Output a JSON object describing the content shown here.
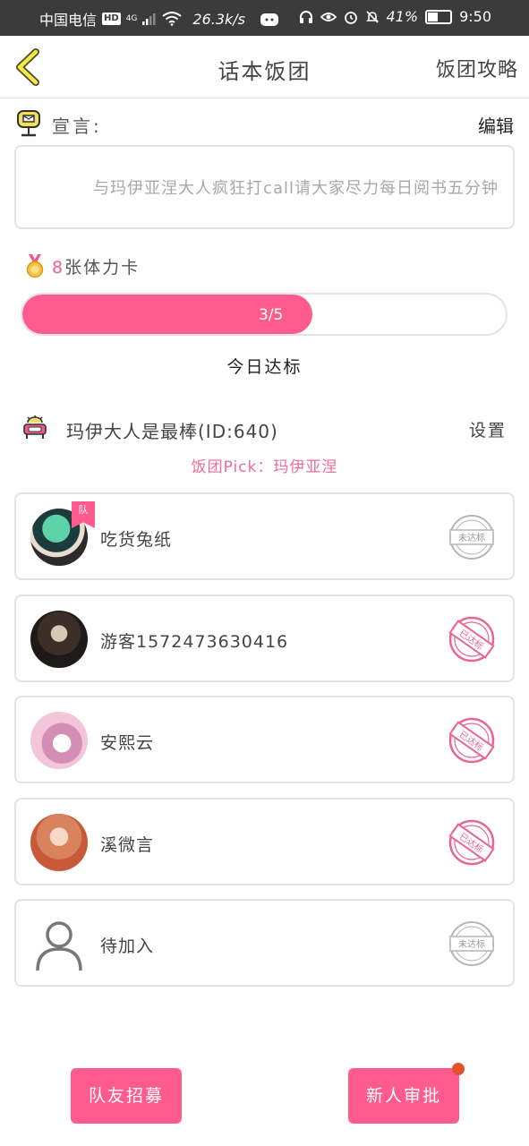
{
  "status_bar": {
    "carrier": "中国电信",
    "hd": "HD",
    "network": "4G",
    "speed": "26.3k/s",
    "battery": "41%",
    "time": "9:50"
  },
  "header": {
    "title": "话本饭团",
    "guide_label": "饭团攻略"
  },
  "declaration": {
    "label": "宣言:",
    "edit_label": "编辑",
    "text": "与玛伊亚涅大人疯狂打call请大家尽力每日阅书五分钟"
  },
  "stamina": {
    "count": "8",
    "suffix": "张体力卡"
  },
  "progress": {
    "label": "3/5",
    "current": 3,
    "total": 5,
    "today_label": "今日达标"
  },
  "group": {
    "name": "玛伊大人是最棒(ID:640)",
    "settings_label": "设置",
    "pick_label": "饭团Pick：玛伊亚涅"
  },
  "members": [
    {
      "name": "吃货兔纸",
      "leader_tag": "队",
      "status": "未达标"
    },
    {
      "name": "游客1572473630416",
      "status": "已达标"
    },
    {
      "name": "安熙云",
      "status": "已达标"
    },
    {
      "name": "溪微言",
      "status": "已达标"
    },
    {
      "name": "待加入",
      "status": "未达标"
    }
  ],
  "buttons": {
    "recruit": "队友招募",
    "approve": "新人审批"
  },
  "colors": {
    "accent": "#ff5b8e",
    "pick_text": "#f06a9b",
    "notification": "#e2522f"
  }
}
